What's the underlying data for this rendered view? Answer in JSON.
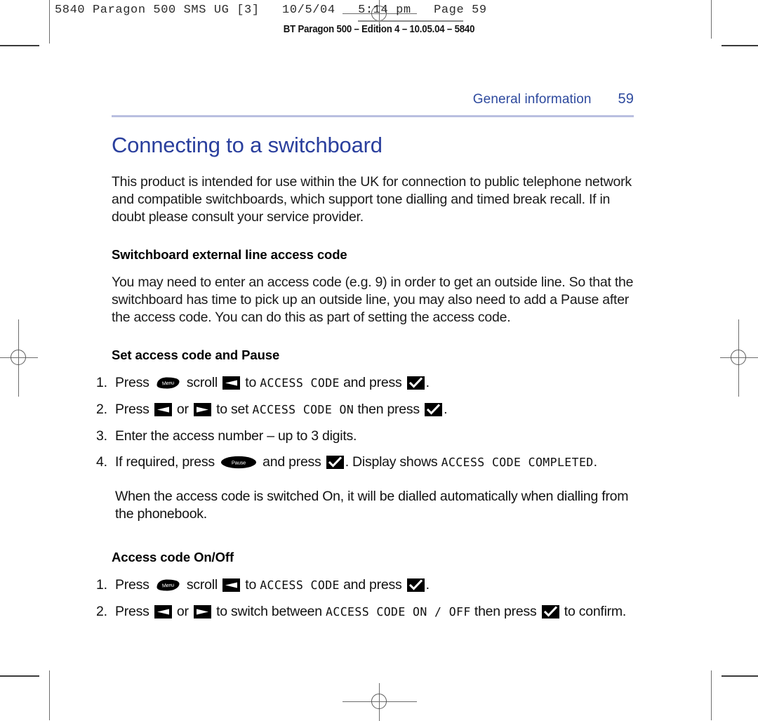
{
  "proof": {
    "stamp": "5840 Paragon 500 SMS UG [3]   10/5/04   5:14 pm   Page 59",
    "subtitle": "BT Paragon 500 – Edition 4 – 10.05.04 – 5840"
  },
  "page": {
    "running_head": "General information",
    "page_number": "59",
    "title": "Connecting to a switchboard",
    "intro": "This product is intended for use within the UK for connection to public telephone network and compatible switchboards, which support tone dialling and timed break recall. If in doubt please consult your service provider.",
    "sections": [
      {
        "heading": "Switchboard external line access code",
        "paragraph": "You may need to enter an access code (e.g. 9) in order to get an outside line. So that the switchboard has time to pick up an outside line, you may also need to add a Pause after the access code. You can do this as part of setting the access code."
      },
      {
        "heading": "Set access code and Pause"
      },
      {
        "heading": "Access code On/Off"
      }
    ],
    "steps_set": [
      {
        "num": "1.",
        "parts": [
          {
            "type": "text",
            "value": "Press "
          },
          {
            "type": "icon",
            "value": "menu-key"
          },
          {
            "type": "text",
            "value": " scroll "
          },
          {
            "type": "icon",
            "value": "left-arrow-key"
          },
          {
            "type": "text",
            "value": " to "
          },
          {
            "type": "lcd",
            "value": "ACCESS CODE"
          },
          {
            "type": "text",
            "value": " and press "
          },
          {
            "type": "icon",
            "value": "tick-key"
          },
          {
            "type": "text",
            "value": "."
          }
        ]
      },
      {
        "num": "2.",
        "parts": [
          {
            "type": "text",
            "value": "Press "
          },
          {
            "type": "icon",
            "value": "left-arrow-key"
          },
          {
            "type": "text",
            "value": " or "
          },
          {
            "type": "icon",
            "value": "right-arrow-key"
          },
          {
            "type": "text",
            "value": " to set "
          },
          {
            "type": "lcd",
            "value": "ACCESS CODE ON"
          },
          {
            "type": "text",
            "value": " then press "
          },
          {
            "type": "icon",
            "value": "tick-key"
          },
          {
            "type": "text",
            "value": "."
          }
        ]
      },
      {
        "num": "3.",
        "parts": [
          {
            "type": "text",
            "value": "Enter the access number – up to 3 digits."
          }
        ]
      },
      {
        "num": "4.",
        "parts": [
          {
            "type": "text",
            "value": "If required, press "
          },
          {
            "type": "icon",
            "value": "pause-key"
          },
          {
            "type": "text",
            "value": " and press "
          },
          {
            "type": "icon",
            "value": "tick-key"
          },
          {
            "type": "text",
            "value": ". Display shows "
          },
          {
            "type": "lcd",
            "value": "ACCESS CODE COMPLETED"
          },
          {
            "type": "text",
            "value": "."
          }
        ]
      }
    ],
    "note": "When the access code is switched On, it will be dialled automatically when dialling from the phonebook.",
    "steps_onoff": [
      {
        "num": "1.",
        "parts": [
          {
            "type": "text",
            "value": "Press "
          },
          {
            "type": "icon",
            "value": "menu-key"
          },
          {
            "type": "text",
            "value": " scroll "
          },
          {
            "type": "icon",
            "value": "left-arrow-key"
          },
          {
            "type": "text",
            "value": " to "
          },
          {
            "type": "lcd",
            "value": "ACCESS CODE"
          },
          {
            "type": "text",
            "value": " and press "
          },
          {
            "type": "icon",
            "value": "tick-key"
          },
          {
            "type": "text",
            "value": "."
          }
        ]
      },
      {
        "num": "2.",
        "parts": [
          {
            "type": "text",
            "value": "Press "
          },
          {
            "type": "icon",
            "value": "left-arrow-key"
          },
          {
            "type": "text",
            "value": " or "
          },
          {
            "type": "icon",
            "value": "right-arrow-key"
          },
          {
            "type": "text",
            "value": " to switch between "
          },
          {
            "type": "lcd",
            "value": "ACCESS CODE ON / OFF"
          },
          {
            "type": "text",
            "value": " then press "
          },
          {
            "type": "icon",
            "value": "tick-key"
          },
          {
            "type": "text",
            "value": " to confirm."
          }
        ]
      }
    ]
  },
  "icon_labels": {
    "menu": "Menu",
    "pause": "Pause"
  },
  "colors": {
    "heading_blue": "#2a3f9d",
    "running_head_blue": "#2e4a9e",
    "rule_blue": "#b9bfe0",
    "key_black": "#000000"
  }
}
